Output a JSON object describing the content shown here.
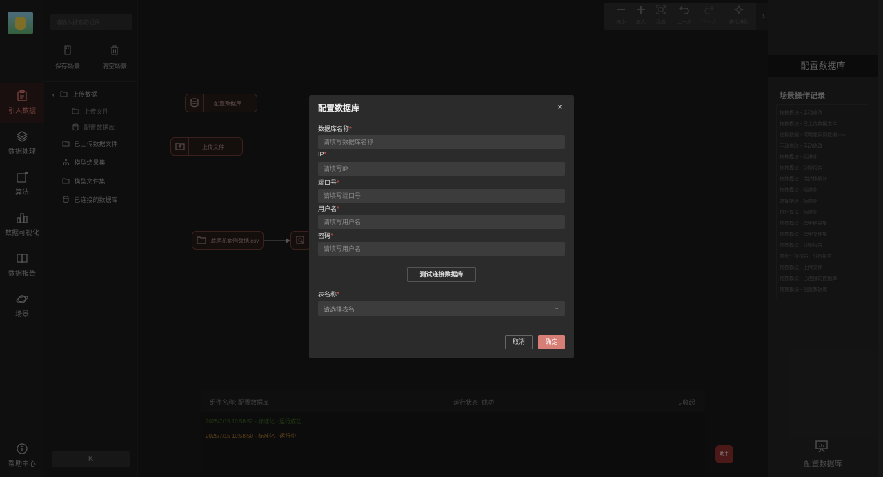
{
  "nav": {
    "items": [
      {
        "label": "引入数据",
        "icon": "clipboard-icon",
        "active": true
      },
      {
        "label": "数据处理",
        "icon": "layers-icon"
      },
      {
        "label": "算法",
        "icon": "algorithm-icon"
      },
      {
        "label": "数据可视化",
        "icon": "bar-chart-icon"
      },
      {
        "label": "数据报告",
        "icon": "book-icon"
      },
      {
        "label": "场景",
        "icon": "planet-icon"
      }
    ],
    "help": "帮助中心"
  },
  "panel": {
    "search_placeholder": "请输入搜索的组件",
    "save_label": "保存场景",
    "clear_label": "清空场景",
    "tree": {
      "upload_group": "上传数据",
      "upload_file": "上传文件",
      "config_db": "配置数据库",
      "uploaded_files": "已上传数据文件",
      "model_results": "模型结果集",
      "model_files": "模型文件集",
      "connected_db": "已连接的数据库"
    },
    "collapse_label": "K"
  },
  "toolbar": {
    "zoom_out": "缩小",
    "zoom_in": "放大",
    "fit": "适应",
    "undo": "上一步",
    "redo": "下一步",
    "beautify": "美化排列",
    "expand": "›"
  },
  "canvas": {
    "nodes": {
      "config_db": "配置数据库",
      "upload_file": "上传文件",
      "csv_file": "鸢尾花案例数据.csv"
    }
  },
  "log": {
    "component_label": "组件名称: 配置数据库",
    "status_label": "运行状态: 成功",
    "collapse_label": "收起",
    "lines": [
      {
        "text": "2025/7/15 10:58:52 - 标准化 - 运行成功",
        "color": "#3e6a23"
      },
      {
        "text": "2025/7/15 10:58:50 - 标准化 - 运行中",
        "color": "#b07a2e"
      }
    ]
  },
  "fab_label": "助手",
  "right": {
    "title": "配置数据库",
    "records_title": "场景操作记录",
    "records": [
      "拖拽模块 - 手动修改",
      "拖拽模块 - 已上传数据文件",
      "选择数据 - 鸢尾花案例数据.csv",
      "手动修改 - 手动修改",
      "拖拽模块 - 标准化",
      "拖拽模块 - 分析报告",
      "拖拽模块 - 描述性统计",
      "拖拽模块 - 标准化",
      "选择字段 - 标准化",
      "执行算法 - 标准化",
      "拖拽模块 - 模型结果集",
      "拖拽模块 - 模型文件集",
      "拖拽模块 - 分析报告",
      "查看分析报告 - 分析报告",
      "拖拽模块 - 上传文件",
      "拖拽模块 - 已连接的数据库",
      "拖拽模块 - 配置数据库"
    ],
    "footer_label": "配置数据库"
  },
  "modal": {
    "title": "配置数据库",
    "fields": [
      {
        "label": "数据库名称",
        "placeholder": "请填写数据库名称"
      },
      {
        "label": "IP",
        "placeholder": "请填写IP"
      },
      {
        "label": "端口号",
        "placeholder": "请填写端口号"
      },
      {
        "label": "用户名",
        "placeholder": "请填写用户名"
      },
      {
        "label": "密码",
        "placeholder": "请填写用户名"
      }
    ],
    "required_mark": "*",
    "test_button": "测试连接数据库",
    "table_label": "表名称",
    "table_placeholder": "请选择表名",
    "cancel": "取消",
    "ok": "确定",
    "close": "×"
  }
}
